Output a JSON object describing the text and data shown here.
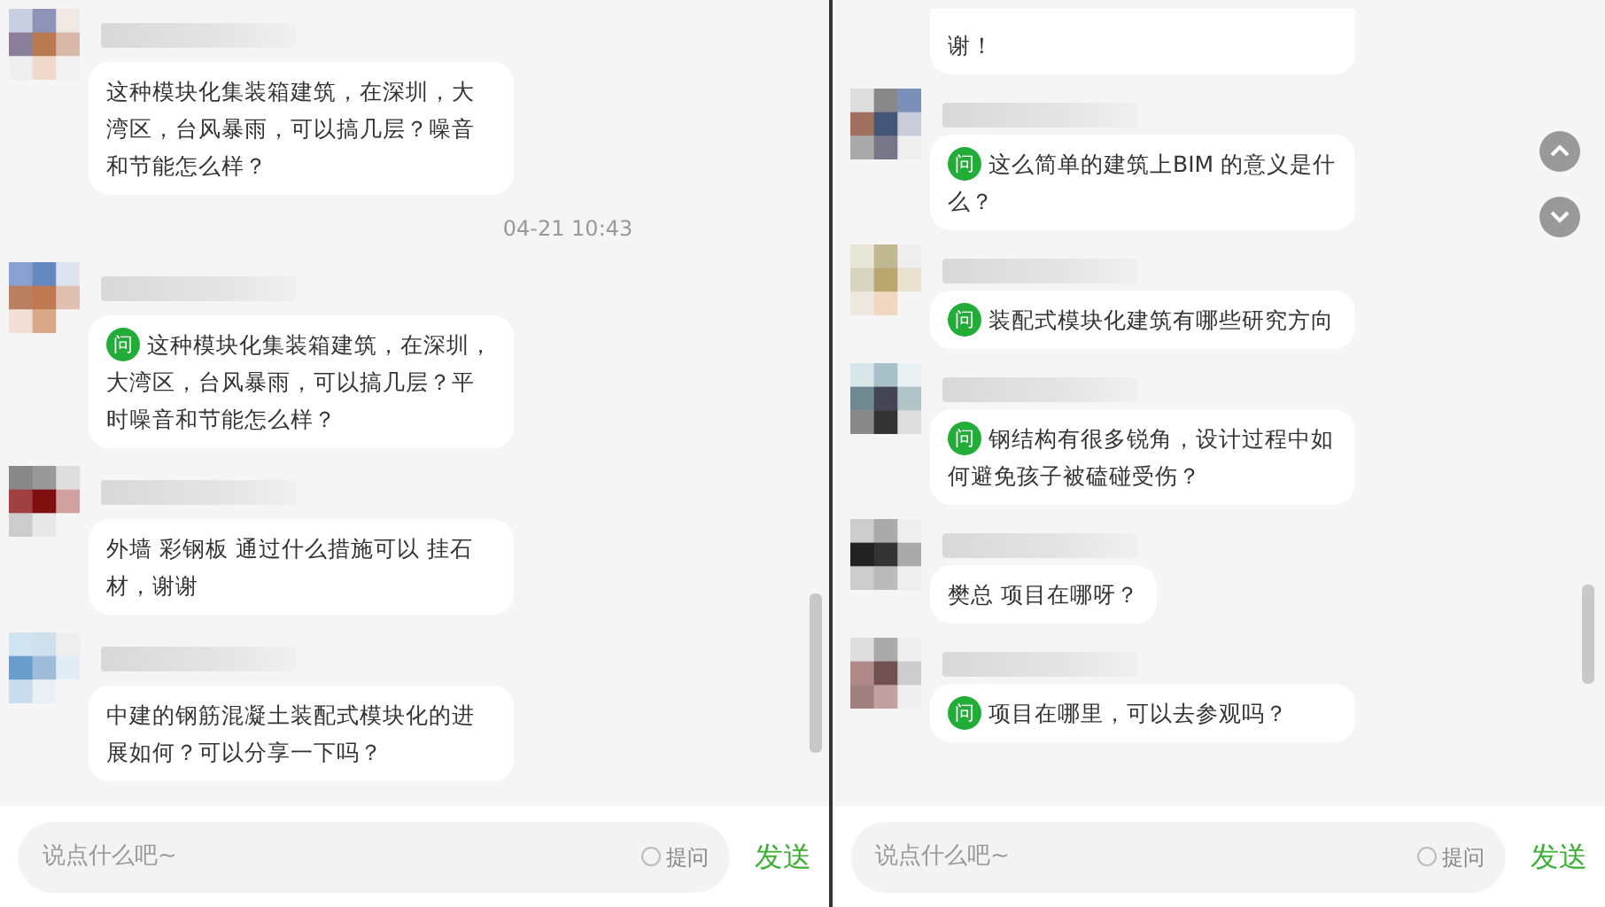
{
  "panels": [
    {
      "messages": [
        {
          "kind": "message",
          "text": "这种模块化集装箱建筑，在深圳，大湾区，台风暴雨，可以搞几层？噪音和节能怎么样？"
        },
        {
          "kind": "time",
          "text": "04-21 10:43"
        },
        {
          "kind": "message",
          "badge": "问",
          "text": "这种模块化集装箱建筑，在深圳，大湾区，台风暴雨，可以搞几层？平时噪音和节能怎么样？"
        },
        {
          "kind": "message",
          "text": "外墙 彩钢板 通过什么措施可以 挂石材，谢谢"
        },
        {
          "kind": "message",
          "text": "中建的钢筋混凝土装配式模块化的进展如何？可以分享一下吗？"
        }
      ],
      "input": {
        "placeholder": "说点什么吧~",
        "option": {
          "label": "提问",
          "checked": false
        },
        "send": "发送"
      },
      "jump_buttons": false
    },
    {
      "messages": [
        {
          "kind": "partial",
          "text": "谢！"
        },
        {
          "kind": "message",
          "badge": "问",
          "text": "这么简单的建筑上BIM 的意义是什么？"
        },
        {
          "kind": "message",
          "badge": "问",
          "text": "装配式模块化建筑有哪些研究方向"
        },
        {
          "kind": "message",
          "badge": "问",
          "text": "钢结构有很多锐角，设计过程中如何避免孩子被磕碰受伤？"
        },
        {
          "kind": "message",
          "text": "樊总 项目在哪呀？"
        },
        {
          "kind": "message",
          "badge": "问",
          "text": "项目在哪里，可以去参观吗？"
        }
      ],
      "input": {
        "placeholder": "说点什么吧~",
        "option": {
          "label": "提问",
          "checked": false
        },
        "send": "发送"
      },
      "jump_buttons": true
    }
  ]
}
